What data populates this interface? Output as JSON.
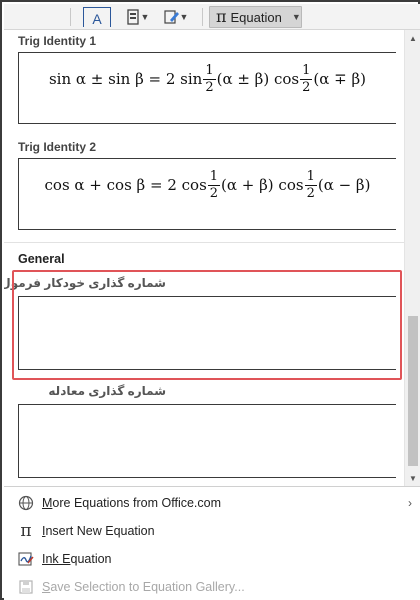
{
  "ribbon": {
    "textbox_glyph": "A",
    "equation_label": "Equation",
    "equation_glyph": "π"
  },
  "gallery": {
    "sections": [
      {
        "title": "Trig Identity 1",
        "equation": {
          "lhs": "sin α ± sin β = 2 sin",
          "mid1": "(α ± β) cos",
          "tail": "(α ∓ β)",
          "frac_num": "1",
          "frac_den": "2"
        }
      },
      {
        "title": "Trig Identity 2",
        "equation": {
          "lhs": "cos α + cos β = 2 cos",
          "mid1": "(α + β) cos",
          "tail": "(α − β)",
          "frac_num": "1",
          "frac_den": "2"
        }
      }
    ],
    "general_header": "General",
    "custom_items": [
      {
        "label": "شماره گذاری خودکار فرمول ها"
      },
      {
        "label": "شماره گذاری معادله"
      }
    ]
  },
  "menu": {
    "items": [
      {
        "prefix": "M",
        "label": "ore Equations from Office.com",
        "disabled": false,
        "icon": "globe-icon"
      },
      {
        "prefix": "I",
        "label": "nsert New Equation",
        "disabled": false,
        "icon": "pi-icon"
      },
      {
        "prefix": "Ink E",
        "label": "quation",
        "disabled": false,
        "icon": "ink-equation-icon"
      },
      {
        "prefix": "S",
        "label": "ave Selection to Equation Gallery...",
        "disabled": true,
        "icon": "save-icon"
      }
    ]
  },
  "colors": {
    "highlight": "#e05458",
    "accent": "#2b579a"
  }
}
